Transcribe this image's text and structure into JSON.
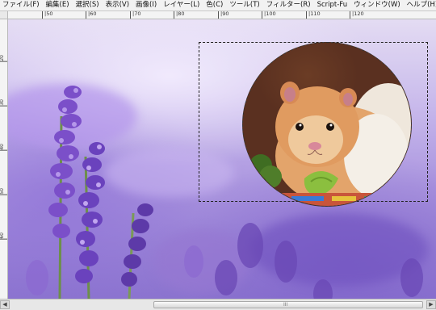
{
  "menu": {
    "items": [
      "ファイル(F)",
      "編集(E)",
      "選択(S)",
      "表示(V)",
      "画像(I)",
      "レイヤー(L)",
      "色(C)",
      "ツール(T)",
      "フィルター(R)",
      "Script-Fu",
      "ウィンドウ(W)",
      "ヘルプ(H)"
    ]
  },
  "ruler": {
    "h_labels": [
      "|50",
      "|60",
      "|70",
      "|80",
      "|90",
      "|100",
      "|110",
      "|120"
    ],
    "v_labels": [
      "20",
      "30",
      "40",
      "50",
      "60"
    ]
  },
  "canvas": {
    "background_color": "#a892de",
    "selection_color": "#222222",
    "hamster_fur": "#d9935a",
    "broccoli": "#4f7d2a"
  },
  "scrollbar": {
    "left_arrow": "◀",
    "right_arrow": "▶",
    "grip": "III"
  }
}
